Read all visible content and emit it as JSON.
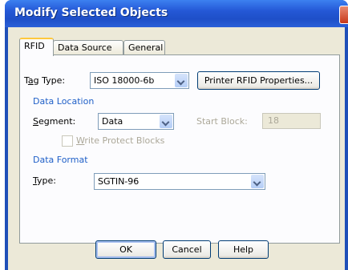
{
  "window": {
    "title": "Modify Selected Objects"
  },
  "tabs": [
    {
      "label": "RFID"
    },
    {
      "label": "Data Source"
    },
    {
      "label": "General"
    }
  ],
  "rfid": {
    "tag_type_label": "Tag Type:",
    "tag_type_value": "ISO 18000-6b",
    "printer_button": "Printer RFID Properties...",
    "data_location_group": "Data Location",
    "segment_label": "Segment:",
    "segment_value": "Data",
    "start_block_label": "Start Block:",
    "start_block_value": "18",
    "write_protect_label": "Write Protect Blocks",
    "data_format_group": "Data Format",
    "type_label": "Type:",
    "type_value": "SGTIN-96"
  },
  "buttons": {
    "ok": "OK",
    "cancel": "Cancel",
    "help": "Help"
  },
  "colors": {
    "titlebar": "#2458d6",
    "client": "#ece9d8",
    "group_label": "#2060c8",
    "tab_highlight": "#ffc83c"
  }
}
